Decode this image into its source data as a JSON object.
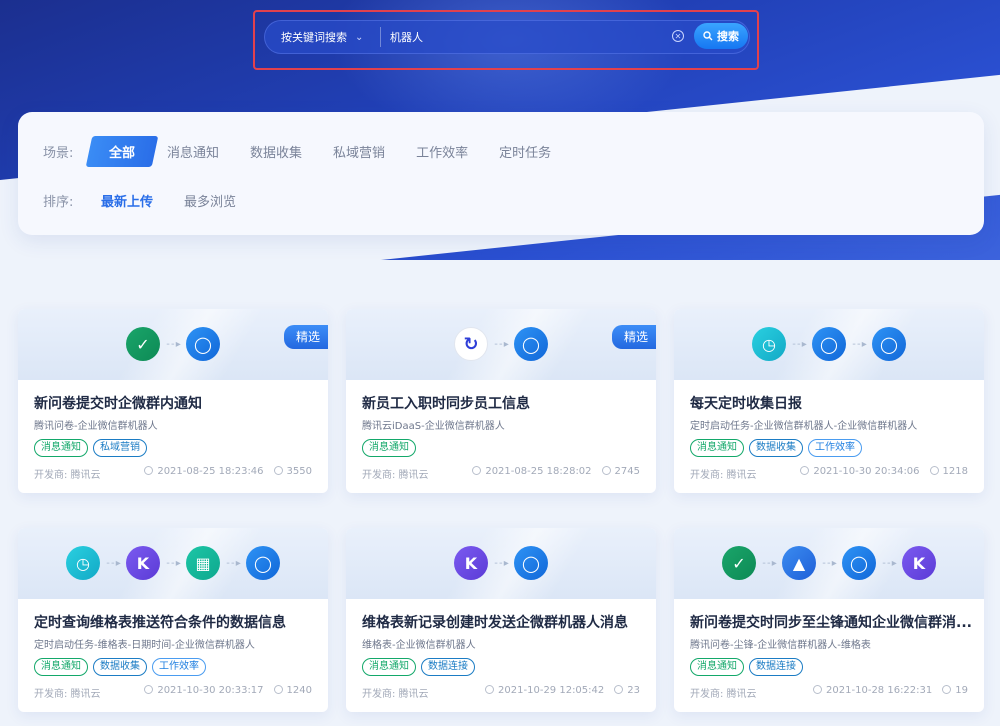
{
  "search": {
    "type_label": "按关键词搜索",
    "value": "机器人",
    "button_label": "搜索"
  },
  "filters": {
    "scene_label": "场景:",
    "scenes": [
      "全部",
      "消息通知",
      "数据收集",
      "私域营销",
      "工作效率",
      "定时任务"
    ],
    "sort_label": "排序:",
    "sorts": [
      "最新上传",
      "最多浏览"
    ]
  },
  "cards": [
    {
      "title": "新问卷提交时企微群内通知",
      "subtitle": "腾讯问卷-企业微信群机器人",
      "tags": [
        "消息通知",
        "私域营销"
      ],
      "featured": "精选",
      "developer": "开发商: 腾讯云",
      "time": "2021-08-25 18:23:46",
      "views": "3550",
      "nodes": [
        "check-icon",
        "wecom-bot-icon"
      ]
    },
    {
      "title": "新员工入职时同步员工信息",
      "subtitle": "腾讯云iDaaS-企业微信群机器人",
      "tags": [
        "消息通知"
      ],
      "featured": "精选",
      "developer": "开发商: 腾讯云",
      "time": "2021-08-25 18:28:02",
      "views": "2745",
      "nodes": [
        "idaas-icon",
        "wecom-bot-icon"
      ]
    },
    {
      "title": "每天定时收集日报",
      "subtitle": "定时启动任务-企业微信群机器人-企业微信群机器人",
      "tags": [
        "消息通知",
        "数据收集",
        "工作效率"
      ],
      "featured": "",
      "developer": "开发商: 腾讯云",
      "time": "2021-10-30 20:34:06",
      "views": "1218",
      "nodes": [
        "alarm-clock-icon",
        "wecom-bot-icon",
        "wecom-bot-icon"
      ]
    },
    {
      "title": "定时查询维格表推送符合条件的数据信息",
      "subtitle": "定时启动任务-维格表-日期时间-企业微信群机器人",
      "tags": [
        "消息通知",
        "数据收集",
        "工作效率"
      ],
      "featured": "",
      "developer": "开发商: 腾讯云",
      "time": "2021-10-30 20:33:17",
      "views": "1240",
      "nodes": [
        "alarm-clock-icon",
        "vika-icon",
        "calendar-icon",
        "wecom-bot-icon"
      ]
    },
    {
      "title": "维格表新记录创建时发送企微群机器人消息",
      "subtitle": "维格表-企业微信群机器人",
      "tags": [
        "消息通知",
        "数据连接"
      ],
      "featured": "",
      "developer": "开发商: 腾讯云",
      "time": "2021-10-29 12:05:42",
      "views": "23",
      "nodes": [
        "vika-icon",
        "wecom-bot-icon"
      ]
    },
    {
      "title": "新问卷提交时同步至尘锋通知企业微信群消...",
      "subtitle": "腾讯问卷-尘锋-企业微信群机器人-维格表",
      "tags": [
        "消息通知",
        "数据连接"
      ],
      "featured": "",
      "developer": "开发商: 腾讯云",
      "time": "2021-10-28 16:22:31",
      "views": "19",
      "nodes": [
        "check-icon",
        "chenfeng-icon",
        "wecom-bot-icon",
        "vika-icon"
      ]
    }
  ],
  "colors": {
    "hero": "#2140b6",
    "accent": "#2a6ee8",
    "tag_green": "#13a86a"
  }
}
